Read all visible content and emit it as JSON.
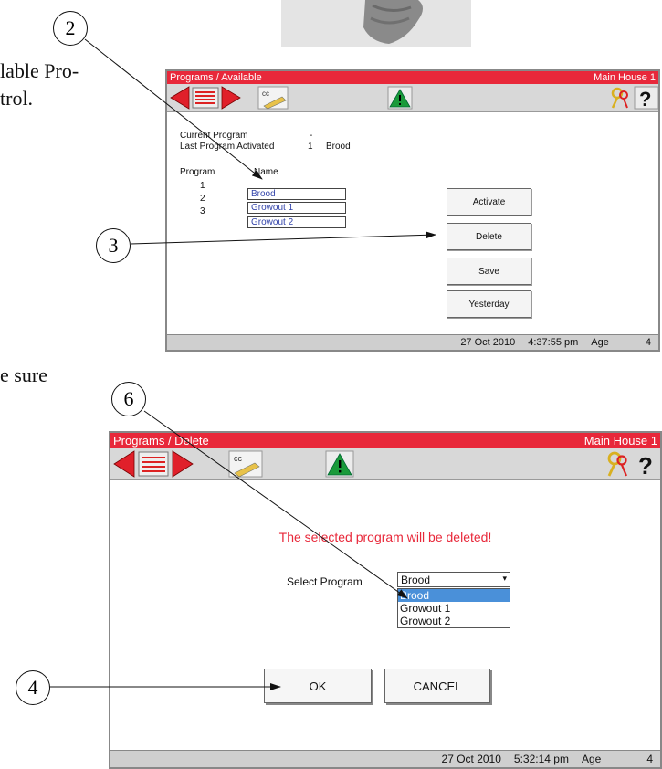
{
  "doc": {
    "line1": "lable Pro-",
    "line2": "trol.",
    "line3": "e sure"
  },
  "callouts": {
    "c2": "2",
    "c3": "3",
    "c6": "6",
    "c4": "4"
  },
  "screen1": {
    "title": "Programs / Available",
    "house": "Main House 1",
    "current_program_label": "Current Program",
    "current_program_value": "-",
    "last_activated_label": "Last Program Activated",
    "last_activated_num": "1",
    "last_activated_name": "Brood",
    "col_program": "Program",
    "col_name": "Name",
    "rows": [
      {
        "num": "1",
        "name": "Brood"
      },
      {
        "num": "2",
        "name": "Growout 1"
      },
      {
        "num": "3",
        "name": "Growout 2"
      }
    ],
    "buttons": {
      "activate": "Activate",
      "delete": "Delete",
      "save": "Save",
      "yesterday": "Yesterday"
    },
    "status": {
      "date": "27 Oct 2010",
      "time": "4:37:55 pm",
      "age_label": "Age",
      "age": "4"
    }
  },
  "screen2": {
    "title": "Programs / Delete",
    "house": "Main House 1",
    "warning": "The selected program will be deleted!",
    "select_label": "Select Program",
    "selected": "Brood",
    "options": [
      "Brood",
      "Growout 1",
      "Growout 2"
    ],
    "ok": "OK",
    "cancel": "CANCEL",
    "status": {
      "date": "27 Oct 2010",
      "time": "5:32:14 pm",
      "age_label": "Age",
      "age": "4"
    }
  },
  "icons": {
    "cc": "cc",
    "help": "?"
  },
  "colors": {
    "titlebar": "#e8283a",
    "toolbar": "#d8d8d8",
    "warning_text": "#e8283a",
    "selected_option": "#4a90d9",
    "nav_red": "#e0202a"
  }
}
